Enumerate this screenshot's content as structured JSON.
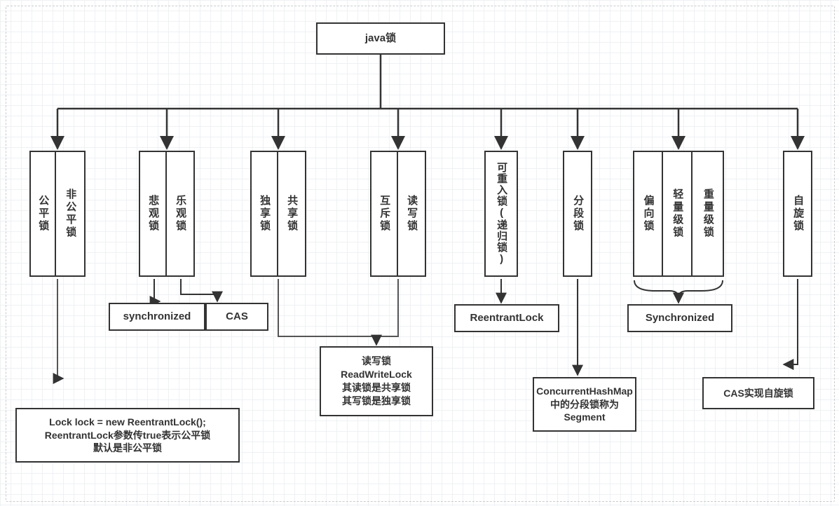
{
  "root": {
    "label": "java锁"
  },
  "groups": [
    {
      "id": "fair",
      "cells": [
        "公平锁",
        "非公平锁"
      ]
    },
    {
      "id": "optimism",
      "cells": [
        "悲观锁",
        "乐观锁"
      ]
    },
    {
      "id": "share",
      "cells": [
        "独享锁",
        "共享锁"
      ]
    },
    {
      "id": "exclusive",
      "cells": [
        "互斥锁",
        "读写锁"
      ]
    },
    {
      "id": "reentrant",
      "cells": [
        "可重入锁(递归锁)"
      ]
    },
    {
      "id": "segment",
      "cells": [
        "分段锁"
      ]
    },
    {
      "id": "bias",
      "cells": [
        "偏向锁",
        "轻量级锁",
        "重量级锁"
      ]
    },
    {
      "id": "spin",
      "cells": [
        "自旋锁"
      ]
    }
  ],
  "leaf": {
    "synchronized": "synchronized",
    "cas": "CAS",
    "reentrantlock": "ReentrantLock",
    "synchronized2": "Synchronized"
  },
  "notes": {
    "fair": "Lock lock = new ReentrantLock();\nReentrantLock参数传true表示公平锁\n默认是非公平锁",
    "rwlock": "读写锁\nReadWriteLock\n其读锁是共享锁\n其写锁是独享锁",
    "segment": "ConcurrentHashMap中的分段锁称为Segment",
    "spin": "CAS实现自旋锁"
  }
}
